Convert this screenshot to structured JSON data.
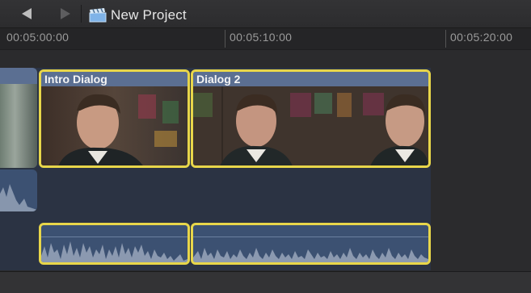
{
  "toolbar": {
    "back_icon": "triangle-left-icon",
    "forward_icon": "triangle-right-icon",
    "project_icon": "clapperboard-icon",
    "project_title": "New Project"
  },
  "ruler": {
    "timecodes": [
      "00:05:00:00",
      "00:05:10:00",
      "00:05:20:00"
    ]
  },
  "timeline": {
    "clips": [
      {
        "name": "Intro Dialog",
        "selected": true
      },
      {
        "name": "Dialog 2",
        "selected": true
      }
    ]
  },
  "colors": {
    "selection": "#e8d64a",
    "clip_header": "#5b6f92",
    "audio_fill": "#3c5172"
  }
}
